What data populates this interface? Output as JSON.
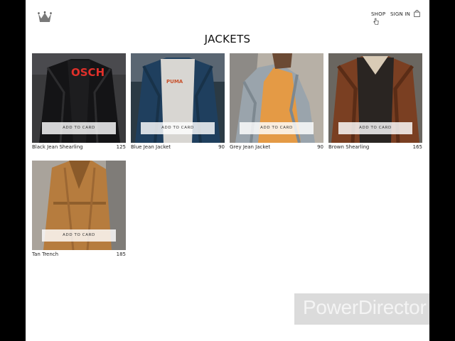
{
  "header": {
    "logo_icon": "crown-icon",
    "nav": {
      "shop": "SHOP",
      "sign_in": "SIGN IN"
    },
    "cart_icon": "shopping-bag-icon"
  },
  "page_title": "JACKETS",
  "products": [
    {
      "name": "Black Jean Shearling",
      "price": "125",
      "button": "ADD TO CARD",
      "image_text": "OSCH"
    },
    {
      "name": "Blue Jean Jacket",
      "price": "90",
      "button": "ADD TO CARD",
      "image_text": "PUMA"
    },
    {
      "name": "Grey Jean Jacket",
      "price": "90",
      "button": "ADD TO CARD"
    },
    {
      "name": "Brown Shearling",
      "price": "165",
      "button": "ADD TO CARD"
    },
    {
      "name": "Tan Trench",
      "price": "185",
      "button": "ADD TO CARD"
    }
  ],
  "watermark": "PowerDirector"
}
